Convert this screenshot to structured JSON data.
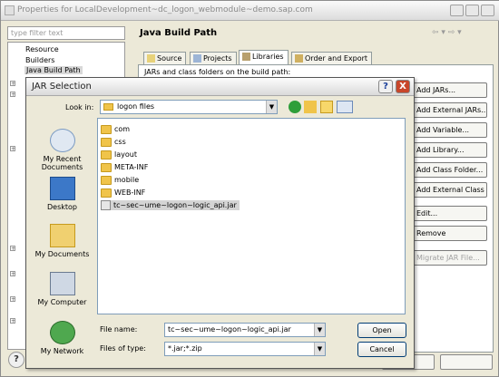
{
  "props_window": {
    "title": "Properties for LocalDevelopment~dc_logon_webmodule~demo.sap.com",
    "filter_placeholder": "type filter text",
    "tree": [
      "Resource",
      "Builders",
      "Java Build Path"
    ],
    "page_title": "Java Build Path",
    "tabs": [
      "Source",
      "Projects",
      "Libraries",
      "Order and Export"
    ],
    "panel_caption": "JARs and class folders on the build path:",
    "side_buttons": [
      "Add JARs...",
      "Add External JARs...",
      "Add Variable...",
      "Add Library...",
      "Add Class Folder...",
      "Add External Class Folder...",
      "Edit...",
      "Remove",
      "Migrate JAR File..."
    ]
  },
  "dialog": {
    "title": "JAR Selection",
    "look_in_label": "Look in:",
    "look_in_value": "logon files",
    "places": [
      "My Recent Documents",
      "Desktop",
      "My Documents",
      "My Computer",
      "My Network"
    ],
    "files": [
      {
        "name": "com",
        "kind": "folder"
      },
      {
        "name": "css",
        "kind": "folder"
      },
      {
        "name": "layout",
        "kind": "folder"
      },
      {
        "name": "META-INF",
        "kind": "folder"
      },
      {
        "name": "mobile",
        "kind": "folder"
      },
      {
        "name": "WEB-INF",
        "kind": "folder"
      },
      {
        "name": "tc~sec~ume~logon~logic_api.jar",
        "kind": "jar"
      }
    ],
    "file_name_label": "File name:",
    "file_name_value": "tc~sec~ume~logon~logic_api.jar",
    "file_type_label": "Files of type:",
    "file_type_value": "*.jar;*.zip",
    "open_label": "Open",
    "cancel_label": "Cancel",
    "help_label": "?",
    "close_label": "X"
  },
  "colors": {
    "selection": "#d4d4d4",
    "close_red": "#c8462a",
    "folder": "#f0c44a"
  }
}
